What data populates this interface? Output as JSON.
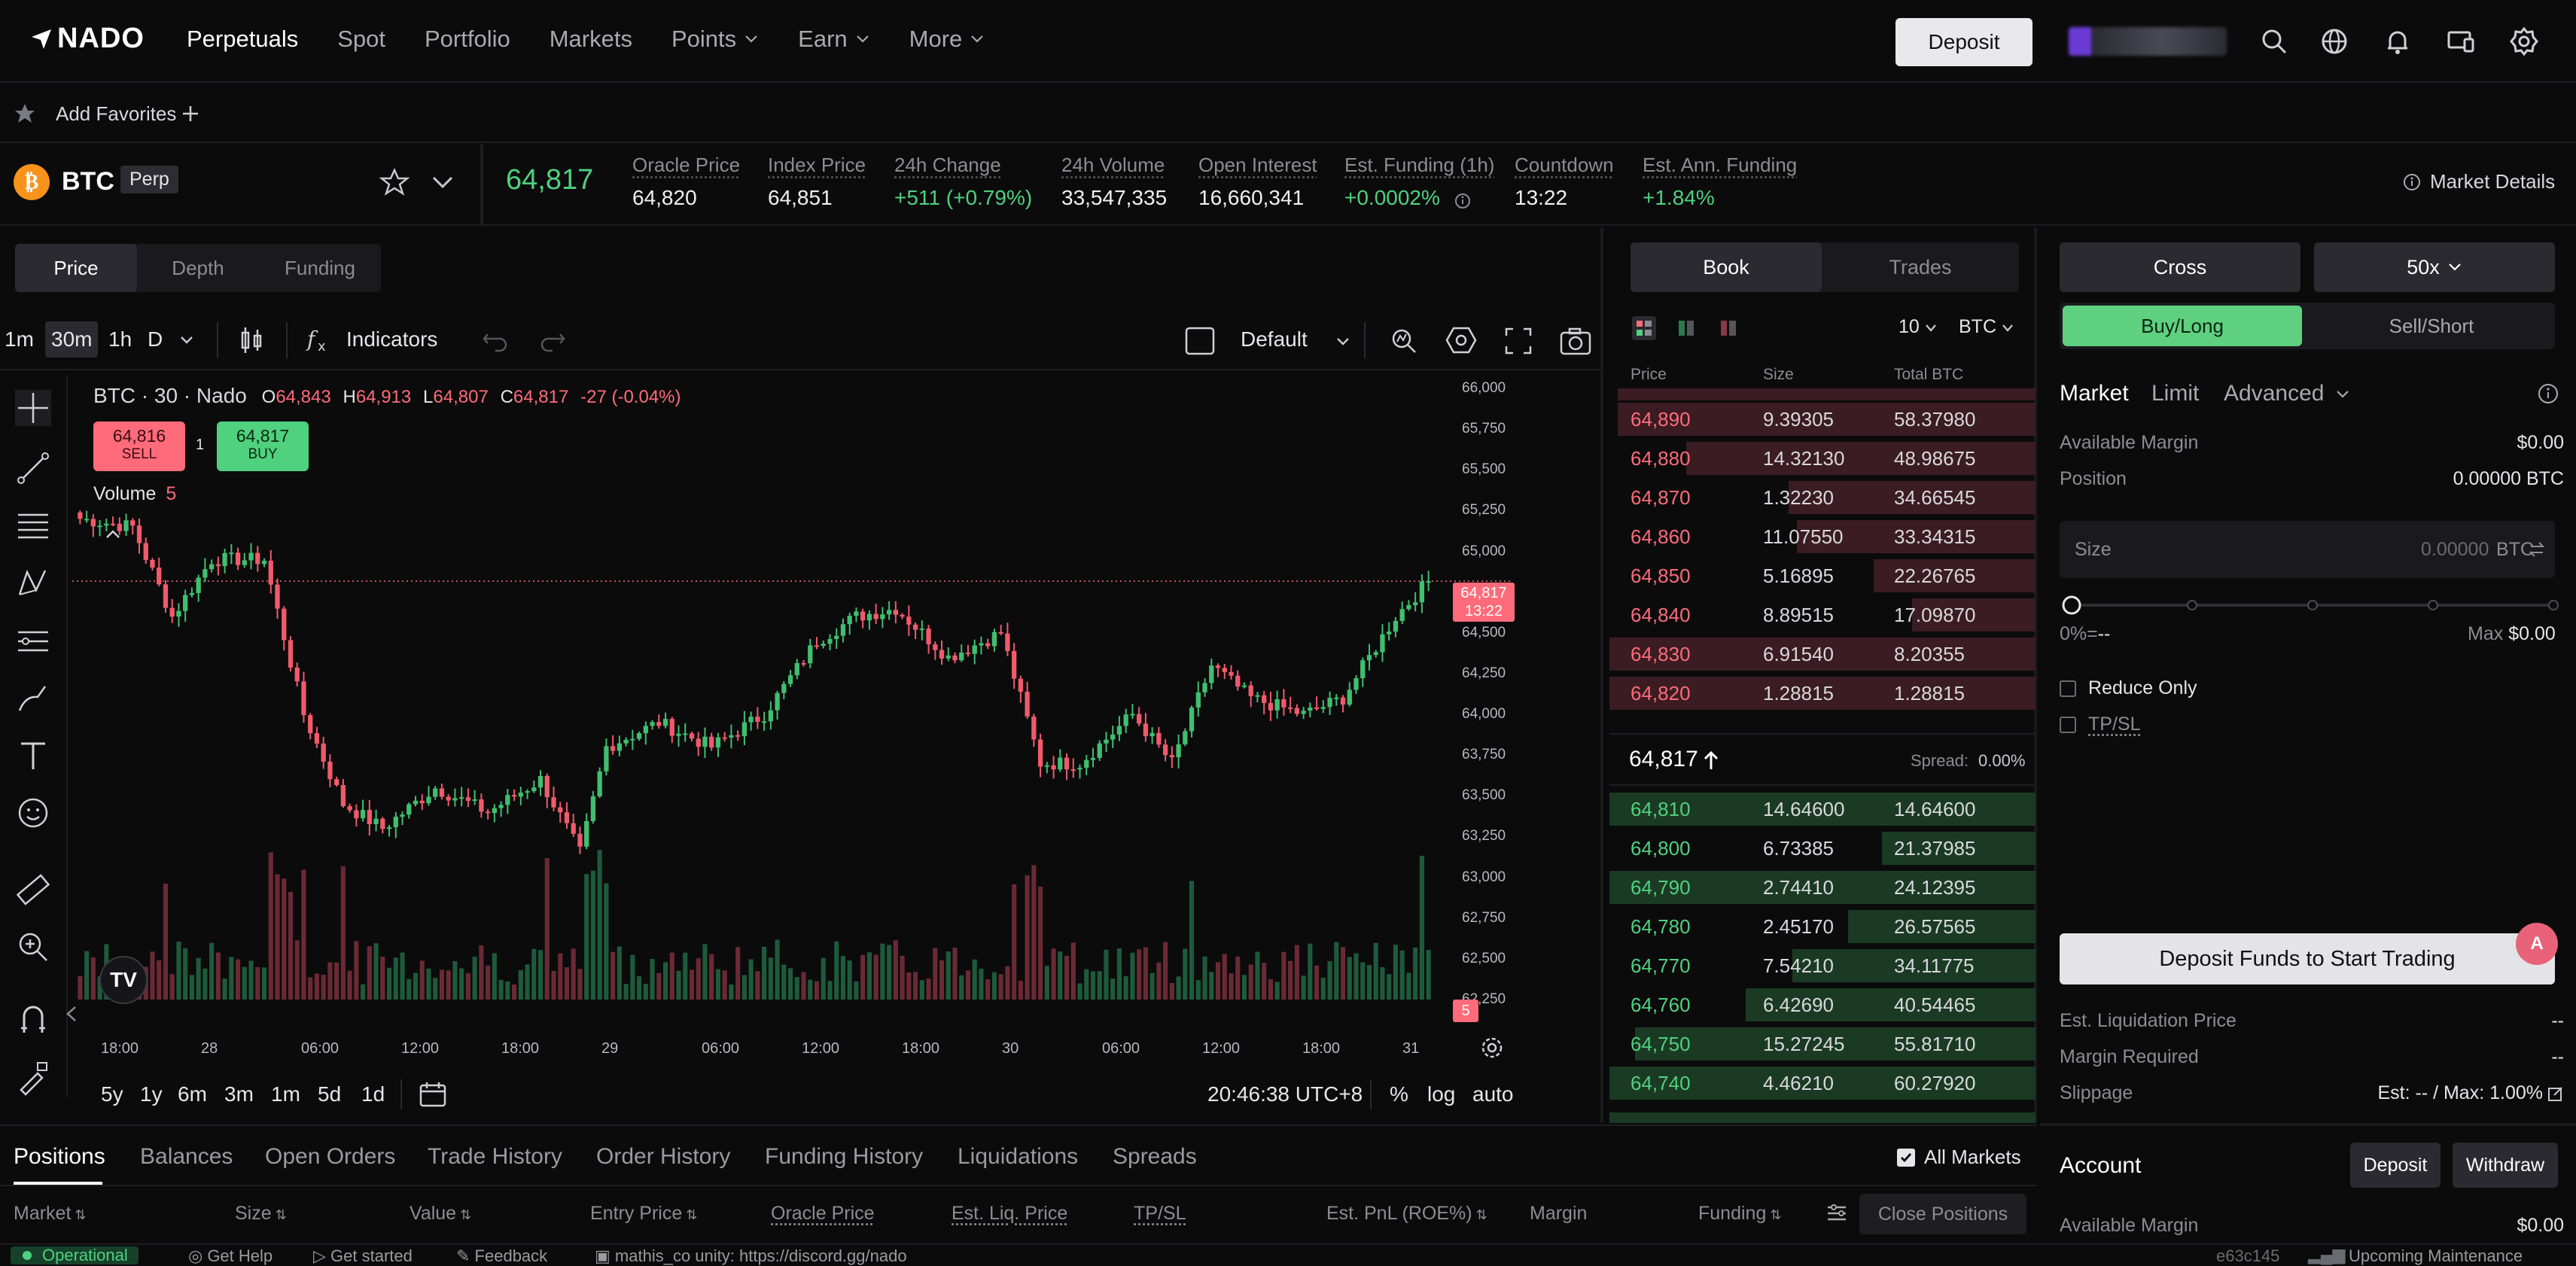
{
  "nav": {
    "logo": "NADO",
    "items": [
      {
        "label": "Perpetuals",
        "active": true,
        "chevron": false
      },
      {
        "label": "Spot",
        "active": false,
        "chevron": false
      },
      {
        "label": "Portfolio",
        "active": false,
        "chevron": false
      },
      {
        "label": "Markets",
        "active": false,
        "chevron": false
      },
      {
        "label": "Points",
        "active": false,
        "chevron": true
      },
      {
        "label": "Earn",
        "active": false,
        "chevron": true
      },
      {
        "label": "More",
        "active": false,
        "chevron": true
      }
    ],
    "deposit": "Deposit",
    "icons": [
      "search-icon",
      "globe-icon",
      "bell-icon",
      "devices-icon",
      "gear-icon"
    ]
  },
  "favorites": {
    "label": "Add Favorites"
  },
  "ticker": {
    "symbol": "BTC",
    "badge": "Perp",
    "last_price": "64,817",
    "market_details": "Market Details",
    "stats": [
      {
        "label": "Oracle Price",
        "value": "64,820",
        "tone": "neutral"
      },
      {
        "label": "Index Price",
        "value": "64,851",
        "tone": "neutral"
      },
      {
        "label": "24h Change",
        "value": "+511 (+0.79%)",
        "tone": "up"
      },
      {
        "label": "24h Volume",
        "value": "33,547,335",
        "tone": "neutral"
      },
      {
        "label": "Open Interest",
        "value": "16,660,341",
        "tone": "neutral"
      },
      {
        "label": "Est. Funding (1h)",
        "value": "+0.0002%",
        "tone": "up"
      },
      {
        "label": "Countdown",
        "value": "13:22",
        "tone": "neutral"
      },
      {
        "label": "Est. Ann. Funding",
        "value": "+1.84%",
        "tone": "up"
      }
    ]
  },
  "chart_tabs": [
    "Price",
    "Depth",
    "Funding"
  ],
  "chart_toolbar": {
    "intervals": [
      "1m",
      "30m",
      "1h",
      "D"
    ],
    "active_interval": "30m",
    "indicators": "Indicators",
    "layout": "Default"
  },
  "legend": {
    "title": "BTC · 30 · Nado",
    "o_label": "O",
    "o": "64,843",
    "h_label": "H",
    "h": "64,913",
    "l_label": "L",
    "l": "64,807",
    "c_label": "C",
    "c": "64,817",
    "chg": "-27 (-0.04%)",
    "sell_price": "64,816",
    "sell": "SELL",
    "spread": "1",
    "buy_price": "64,817",
    "buy": "BUY",
    "volume": "Volume",
    "volume_val": "5"
  },
  "price_tag": {
    "price": "64,817",
    "countdown": "13:22",
    "vol": "5"
  },
  "ranges": [
    "5y",
    "1y",
    "6m",
    "3m",
    "1m",
    "5d",
    "1d"
  ],
  "clock": "20:46:38 UTC+8",
  "scale_opts": [
    "%",
    "log",
    "auto"
  ],
  "chart_data": {
    "type": "candlestick",
    "title": "BTC · 30 · Nado",
    "ylim": [
      62250,
      66000
    ],
    "y_ticks": [
      "66,000",
      "65,750",
      "65,500",
      "65,250",
      "65,000",
      "64,750",
      "64,500",
      "64,250",
      "64,000",
      "63,750",
      "63,500",
      "63,250",
      "63,000",
      "62,750",
      "62,500",
      "62,250"
    ],
    "x_ticks": [
      "18:00",
      "28",
      "06:00",
      "12:00",
      "18:00",
      "29",
      "06:00",
      "12:00",
      "18:00",
      "30",
      "06:00",
      "12:00",
      "18:00",
      "31"
    ],
    "key_points": [
      {
        "x": 0,
        "y": 65200
      },
      {
        "x": 8,
        "y": 65150
      },
      {
        "x": 14,
        "y": 64600
      },
      {
        "x": 20,
        "y": 64950
      },
      {
        "x": 28,
        "y": 64950
      },
      {
        "x": 34,
        "y": 64000
      },
      {
        "x": 40,
        "y": 63450
      },
      {
        "x": 46,
        "y": 63300
      },
      {
        "x": 54,
        "y": 63550
      },
      {
        "x": 62,
        "y": 63400
      },
      {
        "x": 70,
        "y": 63600
      },
      {
        "x": 76,
        "y": 63150
      },
      {
        "x": 80,
        "y": 63800
      },
      {
        "x": 88,
        "y": 63950
      },
      {
        "x": 96,
        "y": 63800
      },
      {
        "x": 104,
        "y": 64000
      },
      {
        "x": 112,
        "y": 64450
      },
      {
        "x": 118,
        "y": 64600
      },
      {
        "x": 124,
        "y": 64650
      },
      {
        "x": 132,
        "y": 64350
      },
      {
        "x": 140,
        "y": 64500
      },
      {
        "x": 146,
        "y": 63700
      },
      {
        "x": 152,
        "y": 63700
      },
      {
        "x": 160,
        "y": 64000
      },
      {
        "x": 166,
        "y": 63700
      },
      {
        "x": 172,
        "y": 64300
      },
      {
        "x": 178,
        "y": 64100
      },
      {
        "x": 186,
        "y": 64000
      },
      {
        "x": 192,
        "y": 64100
      },
      {
        "x": 200,
        "y": 64600
      },
      {
        "x": 205,
        "y": 64817
      }
    ],
    "last": 64817
  },
  "book": {
    "tabs": [
      "Book",
      "Trades"
    ],
    "depth": "10",
    "unit": "BTC",
    "headers": [
      "Price",
      "Size",
      "Total BTC"
    ],
    "asks": [
      {
        "price": "64,890",
        "size": "9.39305",
        "total": "58.37980",
        "depth": 0.98
      },
      {
        "price": "64,880",
        "size": "14.32130",
        "total": "48.98675",
        "depth": 0.82
      },
      {
        "price": "64,870",
        "size": "1.32230",
        "total": "34.66545",
        "depth": 0.58
      },
      {
        "price": "64,860",
        "size": "11.07550",
        "total": "33.34315",
        "depth": 0.56
      },
      {
        "price": "64,850",
        "size": "5.16895",
        "total": "22.26765",
        "depth": 0.38
      },
      {
        "price": "64,840",
        "size": "8.89515",
        "total": "17.09870",
        "depth": 0.29
      },
      {
        "price": "64,830",
        "size": "6.91540",
        "total": "8.20355",
        "depth": 1.0
      },
      {
        "price": "64,820",
        "size": "1.28815",
        "total": "1.28815",
        "depth": 1.0
      }
    ],
    "mid": "64,817",
    "spread_label": "Spread:",
    "spread": "0.00%",
    "bids": [
      {
        "price": "64,810",
        "size": "14.64600",
        "total": "14.64600",
        "depth": 1.0
      },
      {
        "price": "64,800",
        "size": "6.73385",
        "total": "21.37985",
        "depth": 0.36
      },
      {
        "price": "64,790",
        "size": "2.74410",
        "total": "24.12395",
        "depth": 1.0
      },
      {
        "price": "64,780",
        "size": "2.45170",
        "total": "26.57565",
        "depth": 0.44
      },
      {
        "price": "64,770",
        "size": "7.54210",
        "total": "34.11775",
        "depth": 0.57
      },
      {
        "price": "64,760",
        "size": "6.42690",
        "total": "40.54465",
        "depth": 0.68
      },
      {
        "price": "64,750",
        "size": "15.27245",
        "total": "55.81710",
        "depth": 0.94
      },
      {
        "price": "64,740",
        "size": "4.46210",
        "total": "60.27920",
        "depth": 1.0
      }
    ]
  },
  "form": {
    "margin_mode": "Cross",
    "leverage": "50x",
    "buy": "Buy/Long",
    "sell": "Sell/Short",
    "order_types": [
      "Market",
      "Limit",
      "Advanced"
    ],
    "available_margin_label": "Available Margin",
    "available_margin": "$0.00",
    "position_label": "Position",
    "position": "0.00000 BTC",
    "size_label": "Size",
    "size_value": "0.00000",
    "size_unit": "BTC",
    "slider_pct": 0,
    "pct_label": "0%=",
    "pct_value": "--",
    "max_label": "Max",
    "max_value": "$0.00",
    "reduce_only": "Reduce Only",
    "tpsl": "TP/SL",
    "cta": "Deposit Funds to Start Trading",
    "liq_label": "Est. Liquidation Price",
    "liq": "--",
    "margin_req_label": "Margin Required",
    "margin_req": "--",
    "slippage_label": "Slippage",
    "slippage": "Est: -- / Max: 1.00%",
    "account_title": "Account",
    "account_deposit": "Deposit",
    "account_withdraw": "Withdraw",
    "account_margin_label": "Available Margin",
    "account_margin": "$0.00"
  },
  "bottom": {
    "tabs": [
      "Positions",
      "Balances",
      "Open Orders",
      "Trade History",
      "Order History",
      "Funding History",
      "Liquidations",
      "Spreads"
    ],
    "all_markets": "All Markets",
    "columns": [
      "Market",
      "Size",
      "Value",
      "Entry Price",
      "Oracle Price",
      "Est. Liq. Price",
      "TP/SL",
      "Est. PnL (ROE%)",
      "Margin",
      "Funding"
    ],
    "close_positions": "Close Positions"
  },
  "status": {
    "operational": "Operational",
    "help": "Get Help",
    "started": "Get started",
    "feedback": "Feedback",
    "announce": "mathis_co unity: https://discord.gg/nado",
    "version": "e63c145",
    "maintenance": "Upcoming Maintenance"
  },
  "colors": {
    "up": "#4fd17f",
    "down": "#ff6b7a",
    "bg": "#0b0b0c",
    "panel": "#141417"
  }
}
